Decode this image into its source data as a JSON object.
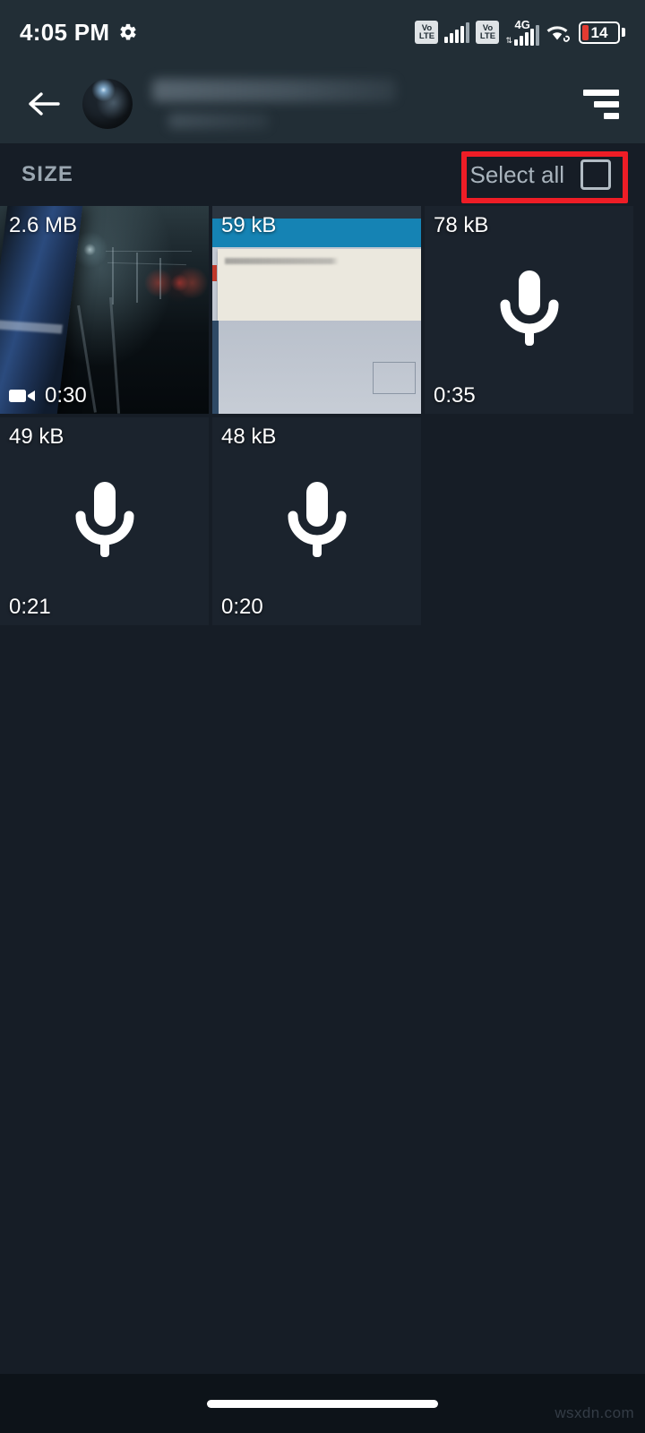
{
  "status_bar": {
    "time": "4:05 PM",
    "gear_icon": "gear-icon",
    "volte_top": "Vo",
    "volte_bottom": "LTE",
    "network_label": "4G",
    "wifi_icon": "wifi-link-icon",
    "battery_percent": "14"
  },
  "app_bar": {
    "back_icon": "back-arrow-icon",
    "avatar": "contact-avatar",
    "title": "",
    "subtitle": "",
    "sort_icon": "sort-icon"
  },
  "section_header": {
    "label": "SIZE",
    "select_all_label": "Select all",
    "checkbox_state": "unchecked",
    "annotation_color": "#ee1d26"
  },
  "media_items": [
    {
      "size": "2.6 MB",
      "duration": "0:30",
      "type": "video",
      "icon": "video-camera-icon",
      "thumb": "night-train-thumbnail"
    },
    {
      "size": "59 kB",
      "duration": "",
      "type": "image",
      "icon": "",
      "thumb": "screenshot-dialog-thumbnail"
    },
    {
      "size": "78 kB",
      "duration": "0:35",
      "type": "audio",
      "icon": "microphone-icon",
      "thumb": ""
    },
    {
      "size": "49 kB",
      "duration": "0:21",
      "type": "audio",
      "icon": "microphone-icon",
      "thumb": ""
    },
    {
      "size": "48 kB",
      "duration": "0:20",
      "type": "audio",
      "icon": "microphone-icon",
      "thumb": ""
    }
  ],
  "nav_bar": {
    "home_pill": "home-indicator"
  },
  "watermark": "wsxdn.com",
  "colors": {
    "app_bar_bg": "#222e36",
    "page_bg": "#161d26",
    "tile_bg": "#1b232d",
    "accent_red": "#ee1d26",
    "battery_red": "#e23b32",
    "volte_chip": "#dfe3e6"
  }
}
